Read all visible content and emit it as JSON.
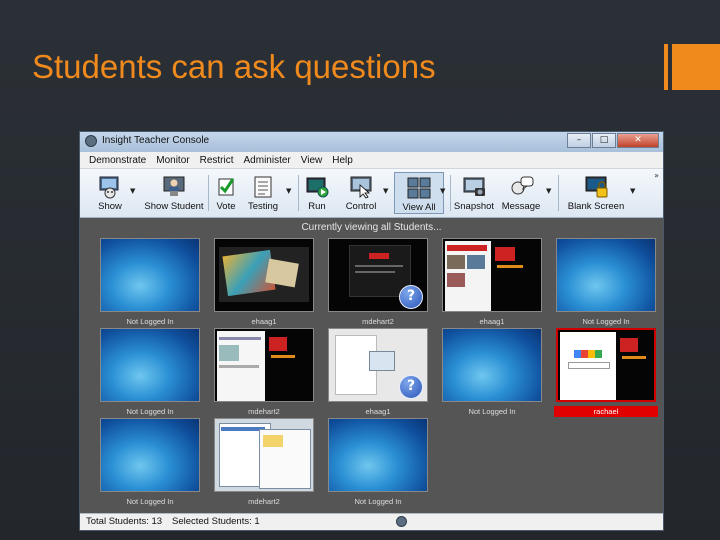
{
  "slide": {
    "title": "Students can ask questions",
    "accent_color": "#f08a1c"
  },
  "window": {
    "title": "Insight Teacher Console",
    "controls": {
      "minimize": "–",
      "maximize": "□",
      "close": "✕"
    },
    "menu": [
      "Demonstrate",
      "Monitor",
      "Restrict",
      "Administer",
      "View",
      "Help"
    ],
    "toolbar": {
      "show": "Show",
      "show_student": "Show Student",
      "vote": "Vote",
      "testing": "Testing",
      "run": "Run",
      "control": "Control",
      "view_all": "View All",
      "snapshot": "Snapshot",
      "message": "Message",
      "blank_screen": "Blank Screen",
      "overflow": "»"
    },
    "caption": "Currently viewing all Students...",
    "thumbnails": [
      {
        "label": "Not Logged In",
        "screen": "desktop",
        "help": false
      },
      {
        "label": "ehaag1",
        "screen": "photo",
        "help": false
      },
      {
        "label": "mdehart2",
        "screen": "dark-web",
        "help": true
      },
      {
        "label": "ehaag1",
        "screen": "web",
        "help": false
      },
      {
        "label": "Not Logged In",
        "screen": "desktop",
        "help": false
      },
      {
        "label": "Not Logged In",
        "screen": "desktop",
        "help": false
      },
      {
        "label": "mdehart2",
        "screen": "web2",
        "help": false
      },
      {
        "label": "ehaag1",
        "screen": "doc",
        "help": true
      },
      {
        "label": "Not Logged In",
        "screen": "desktop",
        "help": false
      },
      {
        "label": "rachael",
        "screen": "google",
        "help": false,
        "selected": true
      },
      {
        "label": "Not Logged In",
        "screen": "desktop",
        "help": false
      },
      {
        "label": "mdehart2",
        "screen": "explorer",
        "help": false
      },
      {
        "label": "Not Logged In",
        "screen": "desktop",
        "help": false
      }
    ],
    "help_glyph": "?",
    "status": {
      "total": "Total Students: 13",
      "selected": "Selected Students: 1"
    }
  }
}
